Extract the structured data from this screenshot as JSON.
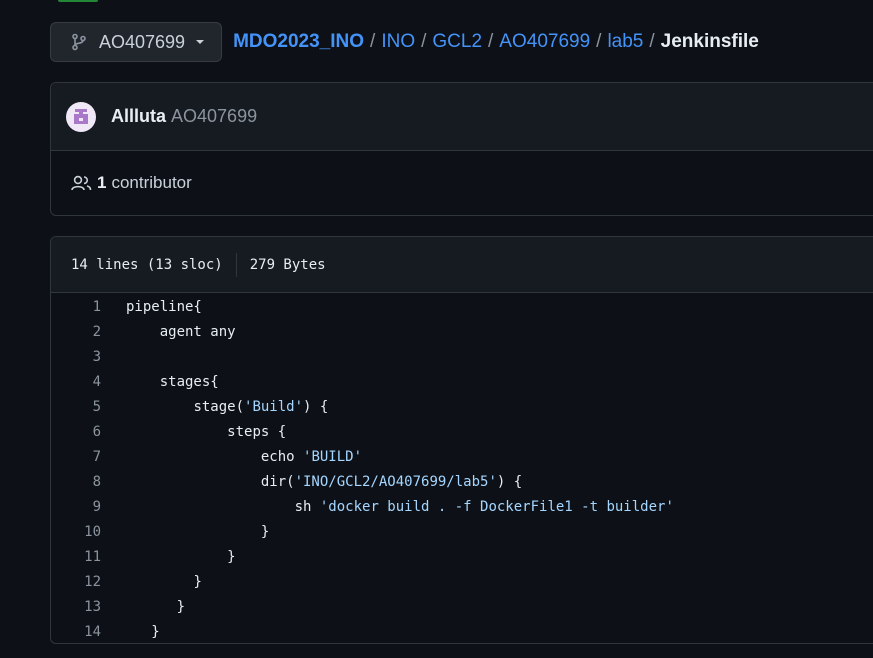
{
  "branch": {
    "name": "AO407699"
  },
  "breadcrumb": {
    "repo": "MDO2023_INO",
    "sep": "/",
    "parts": [
      "INO",
      "GCL2",
      "AO407699",
      "lab5"
    ],
    "file": "Jenkinsfile"
  },
  "commit": {
    "author": "Allluta",
    "author_id": "AO407699"
  },
  "contributors": {
    "count": "1",
    "label": "contributor"
  },
  "file_info": {
    "lines": "14 lines (13 sloc)",
    "size": "279 Bytes"
  },
  "code": {
    "lines": [
      {
        "num": "1",
        "indent": "",
        "pre": "pipeline{",
        "str": "",
        "post": ""
      },
      {
        "num": "2",
        "indent": "    ",
        "pre": "agent any",
        "str": "",
        "post": ""
      },
      {
        "num": "3",
        "indent": "",
        "pre": "",
        "str": "",
        "post": ""
      },
      {
        "num": "4",
        "indent": "    ",
        "pre": "stages{",
        "str": "",
        "post": ""
      },
      {
        "num": "5",
        "indent": "        ",
        "pre": "stage(",
        "str": "'Build'",
        "post": ") {"
      },
      {
        "num": "6",
        "indent": "            ",
        "pre": "steps {",
        "str": "",
        "post": ""
      },
      {
        "num": "7",
        "indent": "                ",
        "pre": "echo ",
        "str": "'BUILD'",
        "post": ""
      },
      {
        "num": "8",
        "indent": "                ",
        "pre": "dir(",
        "str": "'INO/GCL2/AO407699/lab5'",
        "post": ") {"
      },
      {
        "num": "9",
        "indent": "                    ",
        "pre": "sh ",
        "str": "'docker build . -f DockerFile1 -t builder'",
        "post": ""
      },
      {
        "num": "10",
        "indent": "                ",
        "pre": "}",
        "str": "",
        "post": ""
      },
      {
        "num": "11",
        "indent": "            ",
        "pre": "}",
        "str": "",
        "post": ""
      },
      {
        "num": "12",
        "indent": "        ",
        "pre": "}",
        "str": "",
        "post": ""
      },
      {
        "num": "13",
        "indent": "      ",
        "pre": "}",
        "str": "",
        "post": ""
      },
      {
        "num": "14",
        "indent": "   ",
        "pre": "}",
        "str": "",
        "post": ""
      }
    ]
  },
  "colors": {
    "background": "#0d1117",
    "link": "#4493f8",
    "string": "#a5d6ff",
    "border": "#30363d",
    "accent_green": "#238636"
  },
  "icons": {
    "branch": "git-branch-icon",
    "caret": "triangle-down-icon",
    "people": "people-icon"
  }
}
